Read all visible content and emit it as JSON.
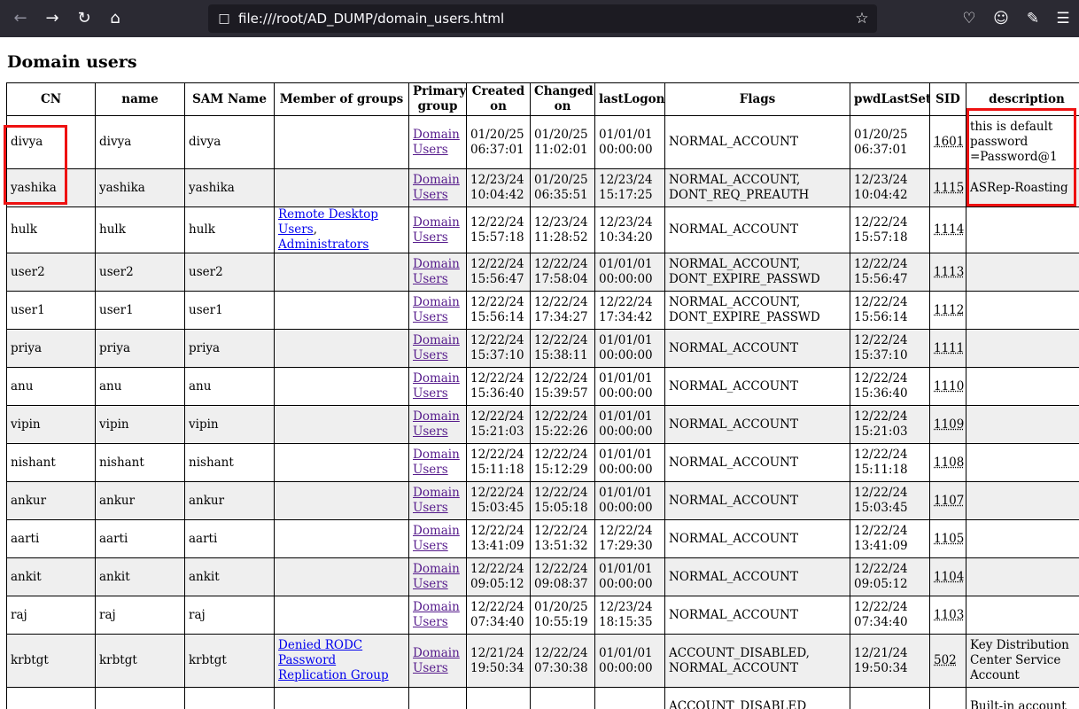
{
  "browser": {
    "url": "file:///root/AD_DUMP/domain_users.html",
    "icons": [
      "back-icon",
      "forward-icon",
      "reload-icon",
      "home-icon",
      "page-icon",
      "bookmark-star-icon",
      "pocket-icon",
      "account-icon",
      "extensions-icon",
      "menu-icon"
    ]
  },
  "page": {
    "title": "Domain users",
    "columns": [
      "CN",
      "name",
      "SAM Name",
      "Member of groups",
      "Primary group",
      "Created on",
      "Changed on",
      "lastLogon",
      "Flags",
      "pwdLastSet",
      "SID",
      "description"
    ],
    "rows": [
      {
        "cn": "divya",
        "name": "divya",
        "sam": "divya",
        "groups": [],
        "primary": "Domain Users",
        "created": "01/20/25 06:37:01",
        "changed": "01/20/25 11:02:01",
        "lastlogon": "01/01/01 00:00:00",
        "flags": "NORMAL_ACCOUNT",
        "pwdlastset": "01/20/25 06:37:01",
        "sid": "1601",
        "description": "this is default password =Password@1"
      },
      {
        "cn": "yashika",
        "name": "yashika",
        "sam": "yashika",
        "groups": [],
        "primary": "Domain Users",
        "created": "12/23/24 10:04:42",
        "changed": "01/20/25 06:35:51",
        "lastlogon": "12/23/24 15:17:25",
        "flags": "NORMAL_ACCOUNT, DONT_REQ_PREAUTH",
        "pwdlastset": "12/23/24 10:04:42",
        "sid": "1115",
        "description": "ASRep-Roasting"
      },
      {
        "cn": "hulk",
        "name": "hulk",
        "sam": "hulk",
        "groups": [
          "Remote Desktop Users",
          "Administrators"
        ],
        "primary": "Domain Users",
        "created": "12/22/24 15:57:18",
        "changed": "12/23/24 11:28:52",
        "lastlogon": "12/23/24 10:34:20",
        "flags": "NORMAL_ACCOUNT",
        "pwdlastset": "12/22/24 15:57:18",
        "sid": "1114",
        "description": ""
      },
      {
        "cn": "user2",
        "name": "user2",
        "sam": "user2",
        "groups": [],
        "primary": "Domain Users",
        "created": "12/22/24 15:56:47",
        "changed": "12/22/24 17:58:04",
        "lastlogon": "01/01/01 00:00:00",
        "flags": "NORMAL_ACCOUNT, DONT_EXPIRE_PASSWD",
        "pwdlastset": "12/22/24 15:56:47",
        "sid": "1113",
        "description": ""
      },
      {
        "cn": "user1",
        "name": "user1",
        "sam": "user1",
        "groups": [],
        "primary": "Domain Users",
        "created": "12/22/24 15:56:14",
        "changed": "12/22/24 17:34:27",
        "lastlogon": "12/22/24 17:34:42",
        "flags": "NORMAL_ACCOUNT, DONT_EXPIRE_PASSWD",
        "pwdlastset": "12/22/24 15:56:14",
        "sid": "1112",
        "description": ""
      },
      {
        "cn": "priya",
        "name": "priya",
        "sam": "priya",
        "groups": [],
        "primary": "Domain Users",
        "created": "12/22/24 15:37:10",
        "changed": "12/22/24 15:38:11",
        "lastlogon": "01/01/01 00:00:00",
        "flags": "NORMAL_ACCOUNT",
        "pwdlastset": "12/22/24 15:37:10",
        "sid": "1111",
        "description": ""
      },
      {
        "cn": "anu",
        "name": "anu",
        "sam": "anu",
        "groups": [],
        "primary": "Domain Users",
        "created": "12/22/24 15:36:40",
        "changed": "12/22/24 15:39:57",
        "lastlogon": "01/01/01 00:00:00",
        "flags": "NORMAL_ACCOUNT",
        "pwdlastset": "12/22/24 15:36:40",
        "sid": "1110",
        "description": ""
      },
      {
        "cn": "vipin",
        "name": "vipin",
        "sam": "vipin",
        "groups": [],
        "primary": "Domain Users",
        "created": "12/22/24 15:21:03",
        "changed": "12/22/24 15:22:26",
        "lastlogon": "01/01/01 00:00:00",
        "flags": "NORMAL_ACCOUNT",
        "pwdlastset": "12/22/24 15:21:03",
        "sid": "1109",
        "description": ""
      },
      {
        "cn": "nishant",
        "name": "nishant",
        "sam": "nishant",
        "groups": [],
        "primary": "Domain Users",
        "created": "12/22/24 15:11:18",
        "changed": "12/22/24 15:12:29",
        "lastlogon": "01/01/01 00:00:00",
        "flags": "NORMAL_ACCOUNT",
        "pwdlastset": "12/22/24 15:11:18",
        "sid": "1108",
        "description": ""
      },
      {
        "cn": "ankur",
        "name": "ankur",
        "sam": "ankur",
        "groups": [],
        "primary": "Domain Users",
        "created": "12/22/24 15:03:45",
        "changed": "12/22/24 15:05:18",
        "lastlogon": "01/01/01 00:00:00",
        "flags": "NORMAL_ACCOUNT",
        "pwdlastset": "12/22/24 15:03:45",
        "sid": "1107",
        "description": ""
      },
      {
        "cn": "aarti",
        "name": "aarti",
        "sam": "aarti",
        "groups": [],
        "primary": "Domain Users",
        "created": "12/22/24 13:41:09",
        "changed": "12/22/24 13:51:32",
        "lastlogon": "12/22/24 17:29:30",
        "flags": "NORMAL_ACCOUNT",
        "pwdlastset": "12/22/24 13:41:09",
        "sid": "1105",
        "description": ""
      },
      {
        "cn": "ankit",
        "name": "ankit",
        "sam": "ankit",
        "groups": [],
        "primary": "Domain Users",
        "created": "12/22/24 09:05:12",
        "changed": "12/22/24 09:08:37",
        "lastlogon": "01/01/01 00:00:00",
        "flags": "NORMAL_ACCOUNT",
        "pwdlastset": "12/22/24 09:05:12",
        "sid": "1104",
        "description": ""
      },
      {
        "cn": "raj",
        "name": "raj",
        "sam": "raj",
        "groups": [],
        "primary": "Domain Users",
        "created": "12/22/24 07:34:40",
        "changed": "01/20/25 10:55:19",
        "lastlogon": "12/23/24 18:15:35",
        "flags": "NORMAL_ACCOUNT",
        "pwdlastset": "12/22/24 07:34:40",
        "sid": "1103",
        "description": ""
      },
      {
        "cn": "krbtgt",
        "name": "krbtgt",
        "sam": "krbtgt",
        "groups": [
          "Denied RODC Password Replication Group"
        ],
        "primary": "Domain Users",
        "created": "12/21/24 19:50:34",
        "changed": "12/22/24 07:30:38",
        "lastlogon": "01/01/01 00:00:00",
        "flags": "ACCOUNT_DISABLED, NORMAL_ACCOUNT",
        "pwdlastset": "12/21/24 19:50:34",
        "sid": "502",
        "description": "Key Distribution Center Service Account"
      },
      {
        "cn": "",
        "name": "",
        "sam": "",
        "groups": [],
        "primary": "",
        "created": "",
        "changed": "",
        "lastlogon": "",
        "flags": "ACCOUNT_DISABLED",
        "pwdlastset": "",
        "sid": "",
        "description": "Built-in account"
      }
    ]
  },
  "colors": {
    "toolbar": "#2b2a33",
    "urlbar": "#1c1b22",
    "link": "#0000ee",
    "visited_link": "#551a8b",
    "alt_row": "#efefef",
    "highlight": "#ee1111"
  }
}
